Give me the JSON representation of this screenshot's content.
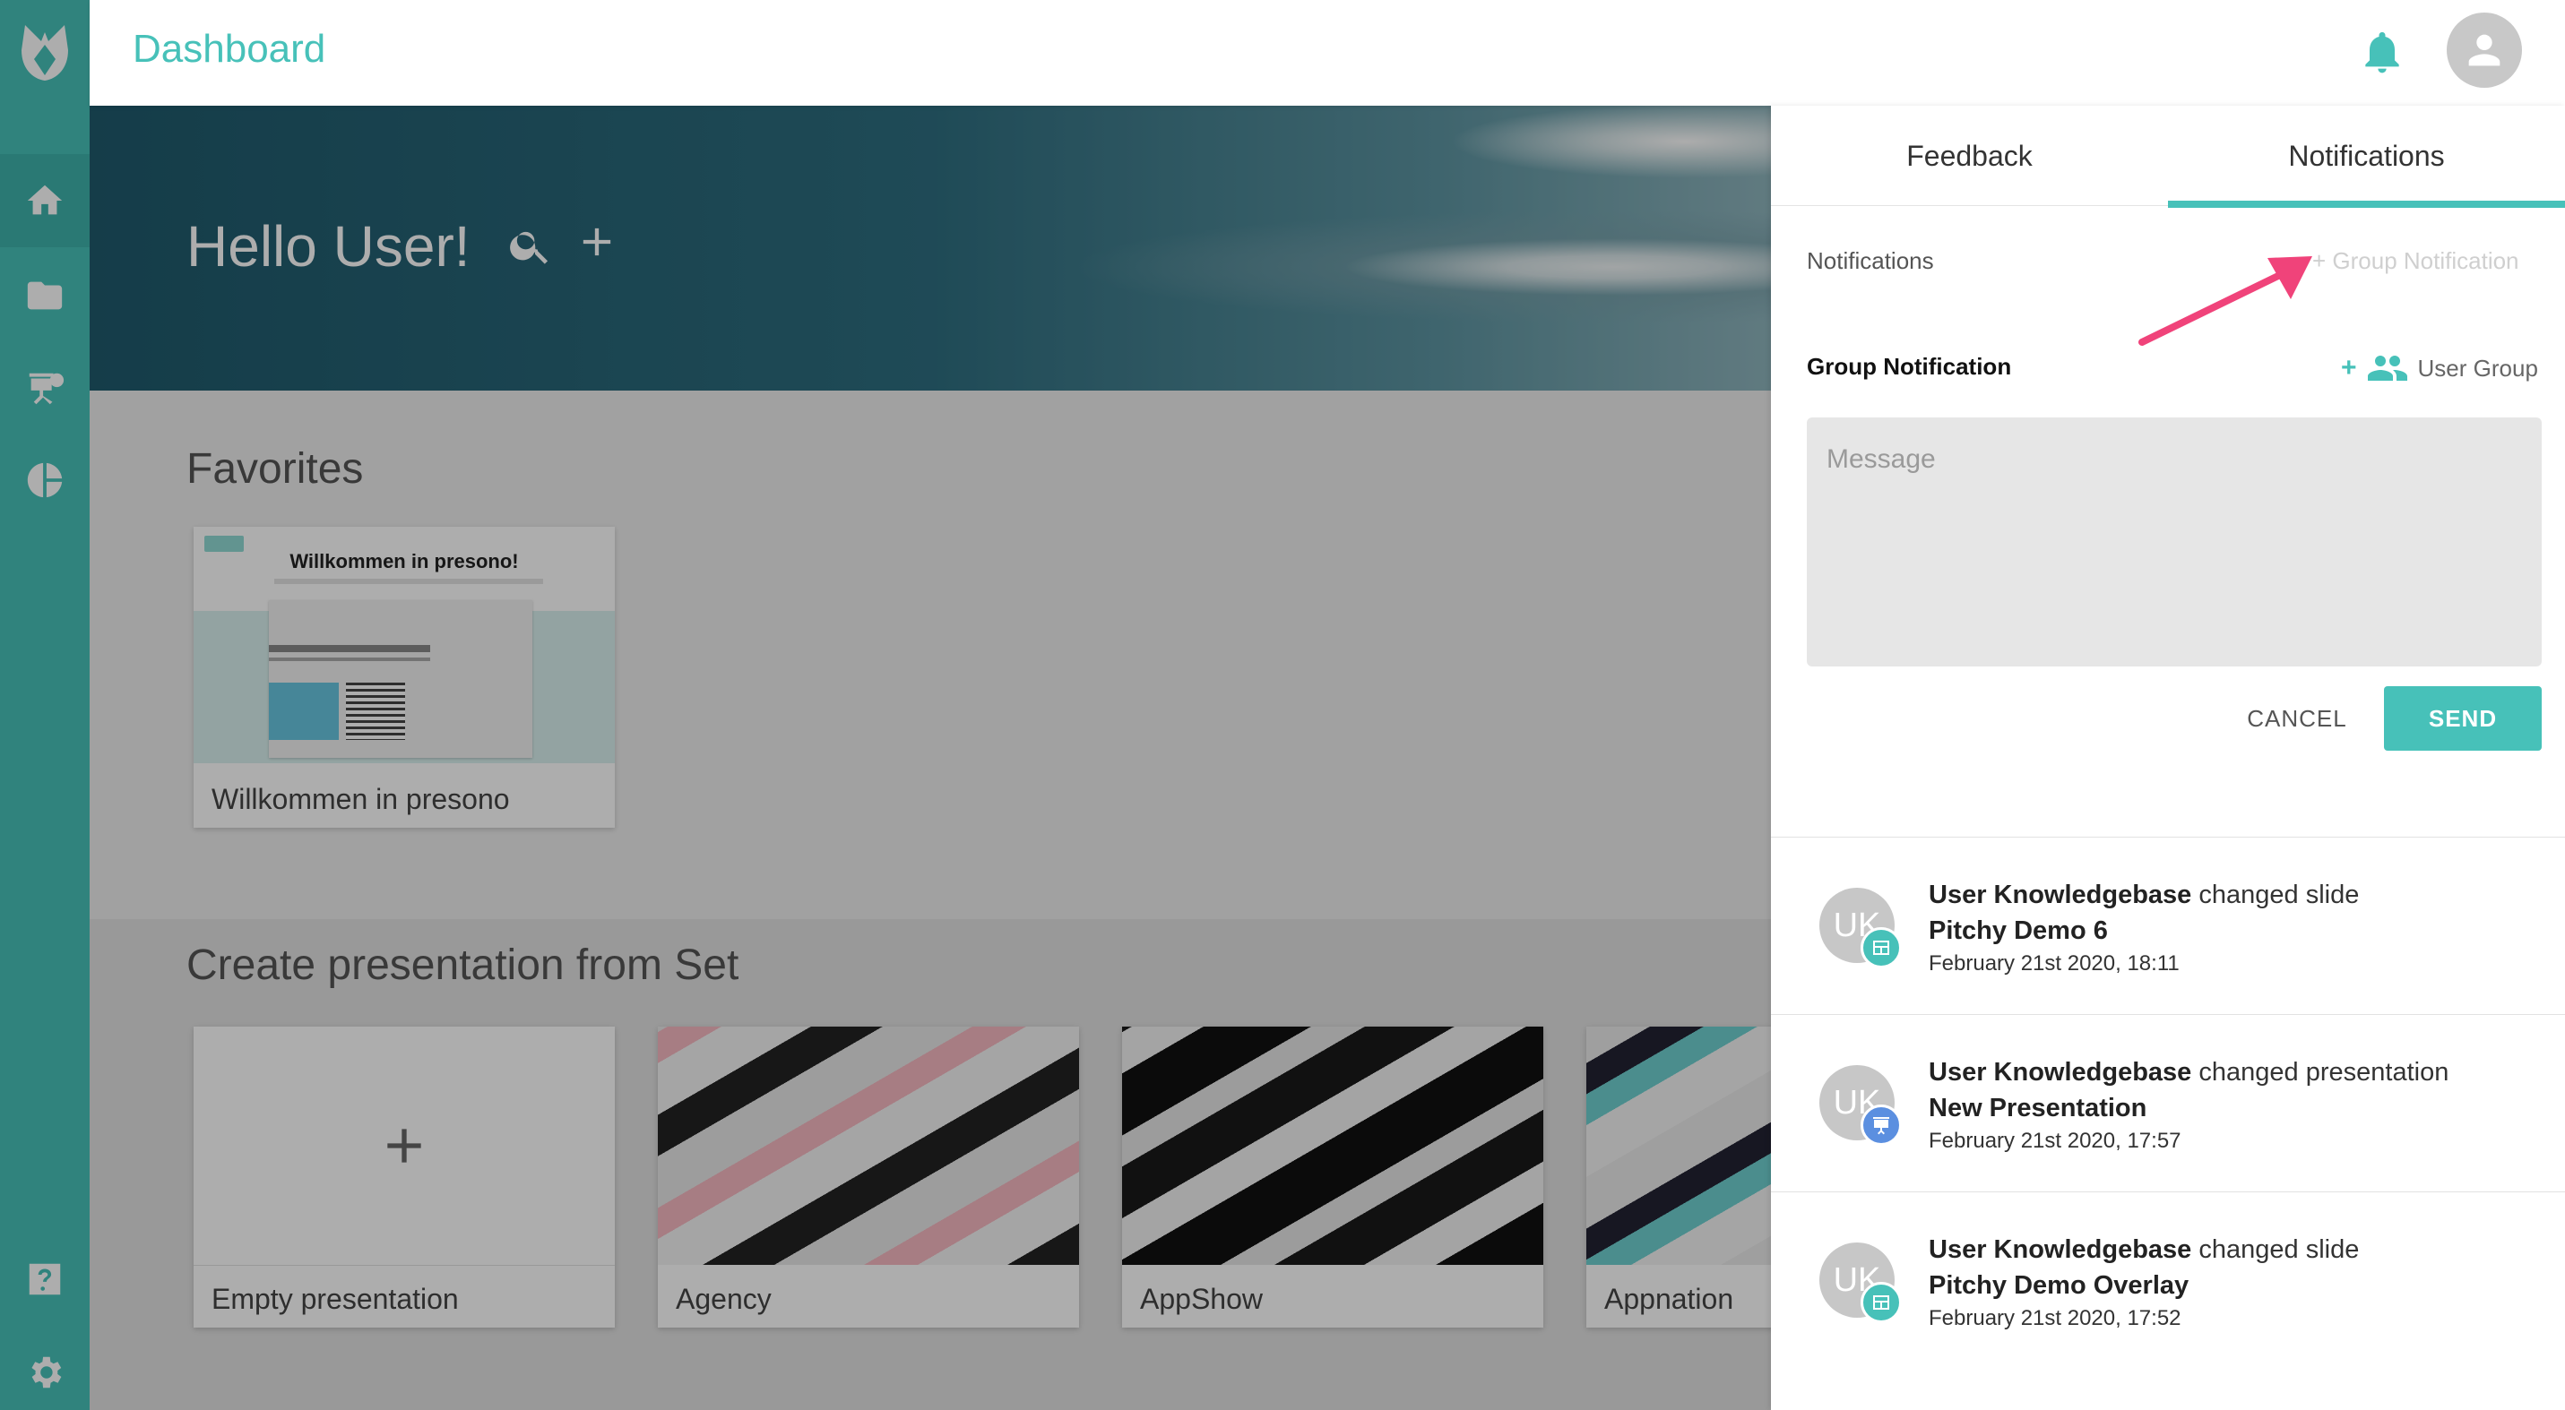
{
  "app": {
    "title": "Dashboard"
  },
  "sidebar": {
    "items": [
      {
        "icon": "home-icon"
      },
      {
        "icon": "folder-icon"
      },
      {
        "icon": "presentation-icon"
      },
      {
        "icon": "analytics-icon"
      },
      {
        "icon": "help-icon"
      },
      {
        "icon": "gear-icon"
      }
    ]
  },
  "hero": {
    "greeting": "Hello User!"
  },
  "favorites": {
    "title": "Favorites",
    "items": [
      {
        "name": "Willkommen in presono",
        "thumb_heading": "Willkommen in presono!"
      }
    ]
  },
  "sets": {
    "title": "Create presentation from Set",
    "items": [
      {
        "name": "Empty presentation"
      },
      {
        "name": "Agency"
      },
      {
        "name": "AppShow"
      },
      {
        "name": "Appnation"
      }
    ]
  },
  "panel": {
    "tabs": [
      "Feedback",
      "Notifications"
    ],
    "active_tab": "Notifications",
    "notifications_label": "Notifications",
    "add_group_link": "+ Group Notification",
    "group_label": "Group Notification",
    "user_group_link": "User Group",
    "message_placeholder": "Message",
    "cancel_label": "CANCEL",
    "send_label": "SEND",
    "list": [
      {
        "initials": "UK",
        "user": "User Knowledgebase",
        "action": "changed slide",
        "target": "Pitchy Demo 6",
        "time": "February 21st 2020, 18:11",
        "badge": "slide-icon",
        "badge_color": "#47c1b9"
      },
      {
        "initials": "UK",
        "user": "User Knowledgebase",
        "action": "changed presentation",
        "target": "New Presentation",
        "time": "February 21st 2020, 17:57",
        "badge": "presentation-icon",
        "badge_color": "#5b8fe0"
      },
      {
        "initials": "UK",
        "user": "User Knowledgebase",
        "action": "changed slide",
        "target": "Pitchy Demo Overlay",
        "time": "February 21st 2020, 17:52",
        "badge": "slide-icon",
        "badge_color": "#47c1b9"
      }
    ]
  },
  "colors": {
    "accent": "#47c1b9",
    "annotation_arrow": "#f0437a"
  }
}
